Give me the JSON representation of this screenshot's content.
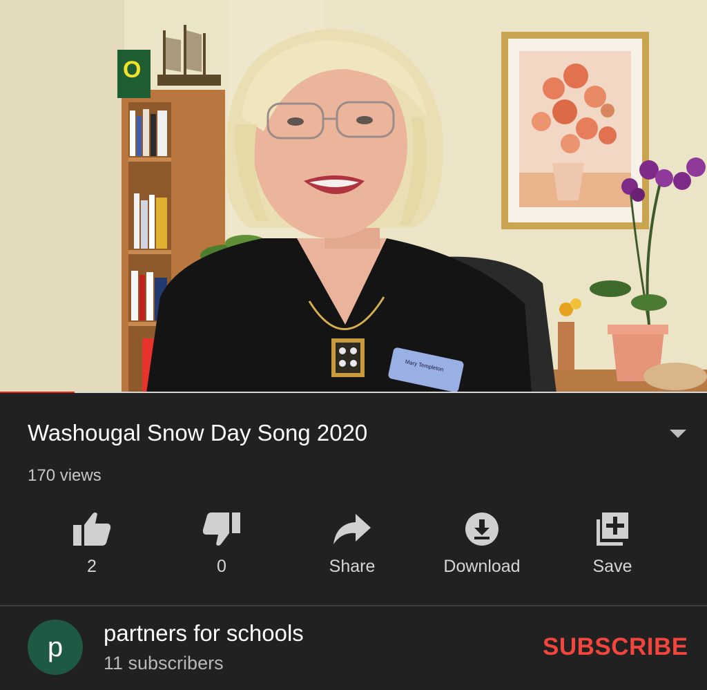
{
  "video": {
    "progress_fraction": 0.105,
    "badge_text": "Mary Templeton",
    "colors": {
      "progress": "#e62117",
      "track": "#d8d8d8"
    }
  },
  "info": {
    "title": "Washougal Snow Day Song 2020",
    "views": "170 views"
  },
  "actions": [
    {
      "icon": "thumb-up-icon",
      "label": "2"
    },
    {
      "icon": "thumb-down-icon",
      "label": "0"
    },
    {
      "icon": "share-icon",
      "label": "Share"
    },
    {
      "icon": "download-icon",
      "label": "Download"
    },
    {
      "icon": "save-playlist-icon",
      "label": "Save"
    }
  ],
  "channel": {
    "avatar_letter": "p",
    "name": "partners for schools",
    "subscribers": "11 subscribers",
    "subscribe_label": "SUBSCRIBE",
    "colors": {
      "avatar": "#1e5a43",
      "subscribe": "#f2453d"
    }
  }
}
